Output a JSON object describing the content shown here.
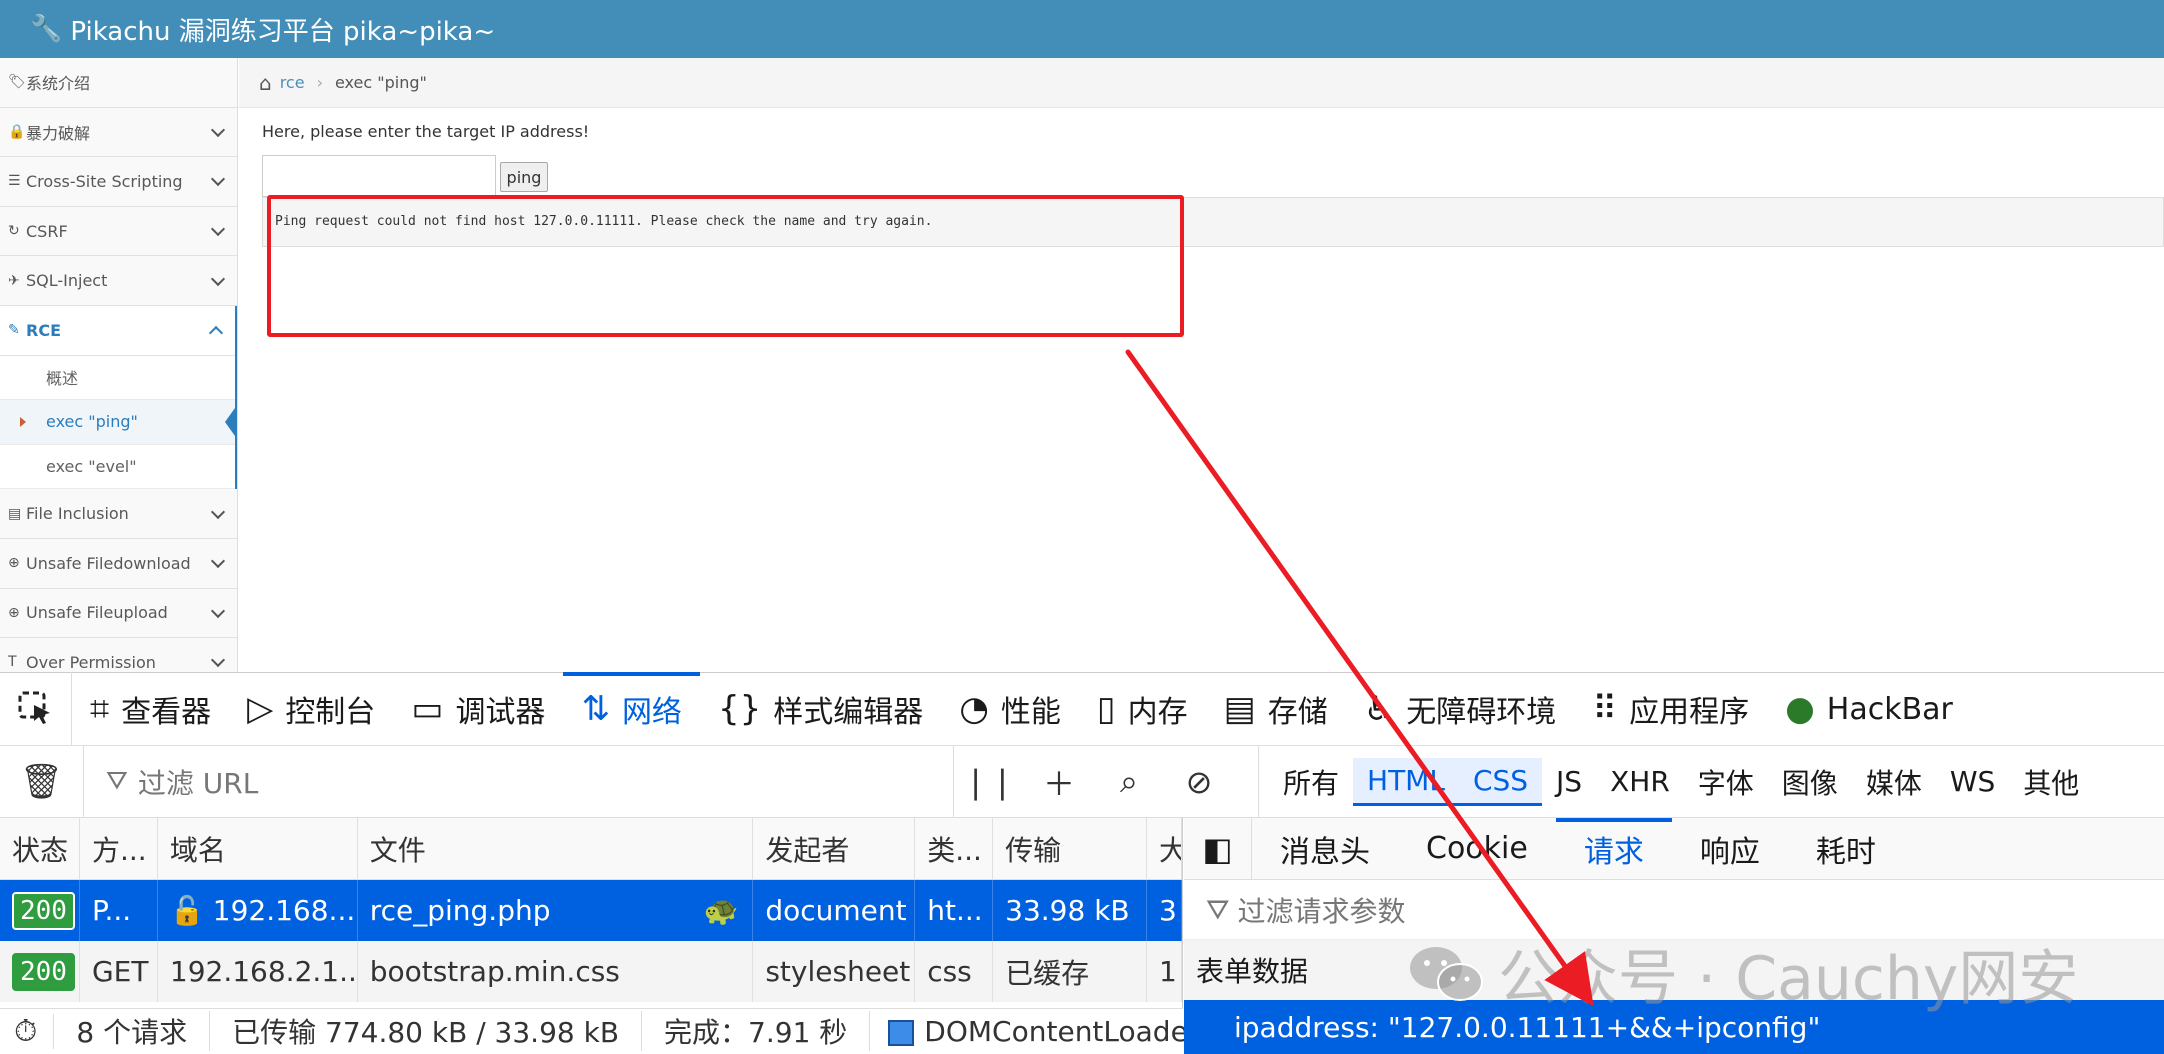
{
  "app": {
    "title": "Pikachu 漏洞练习平台 pika~pika~"
  },
  "sidebar": {
    "items": [
      {
        "label": "系统介绍",
        "icon": "tag-icon",
        "chevron": false
      },
      {
        "label": "暴力破解",
        "icon": "lock-icon",
        "chevron": true
      },
      {
        "label": "Cross-Site Scripting",
        "icon": "list-icon",
        "chevron": true
      },
      {
        "label": "CSRF",
        "icon": "refresh-icon",
        "chevron": true
      },
      {
        "label": "SQL-Inject",
        "icon": "plane-icon",
        "chevron": true
      }
    ],
    "rce": {
      "label": "RCE",
      "icon": "pencil-icon",
      "sub": [
        {
          "label": "概述"
        },
        {
          "label": "exec \"ping\""
        },
        {
          "label": "exec \"evel\""
        }
      ]
    },
    "after": [
      {
        "label": "File Inclusion",
        "icon": "file-icon"
      },
      {
        "label": "Unsafe Filedownload",
        "icon": "download-icon"
      },
      {
        "label": "Unsafe Fileupload",
        "icon": "upload-icon"
      },
      {
        "label": "Over Permission",
        "icon": "text-icon"
      }
    ]
  },
  "breadcrumb": {
    "link": "rce",
    "current": "exec \"ping\""
  },
  "form": {
    "prompt": "Here, please enter the target IP address!",
    "input_value": "",
    "button": "ping",
    "output": "Ping request could not find host 127.0.0.11111. Please check the name and try again."
  },
  "devtools": {
    "tabs": [
      {
        "label": "查看器",
        "icon": "inspector-icon"
      },
      {
        "label": "控制台",
        "icon": "console-icon"
      },
      {
        "label": "调试器",
        "icon": "debugger-icon"
      },
      {
        "label": "网络",
        "icon": "network-icon",
        "selected": true
      },
      {
        "label": "样式编辑器",
        "icon": "style-editor-icon"
      },
      {
        "label": "性能",
        "icon": "performance-icon"
      },
      {
        "label": "内存",
        "icon": "memory-icon"
      },
      {
        "label": "存储",
        "icon": "storage-icon"
      },
      {
        "label": "无障碍环境",
        "icon": "accessibility-icon"
      },
      {
        "label": "应用程序",
        "icon": "application-icon"
      },
      {
        "label": "HackBar",
        "icon": "hackbar-icon"
      }
    ],
    "filter_placeholder": "过滤 URL",
    "type_filters": [
      {
        "label": "所有"
      },
      {
        "label": "HTML",
        "on": true
      },
      {
        "label": "CSS",
        "on": true
      },
      {
        "label": "JS"
      },
      {
        "label": "XHR"
      },
      {
        "label": "字体"
      },
      {
        "label": "图像"
      },
      {
        "label": "媒体"
      },
      {
        "label": "WS"
      },
      {
        "label": "其他"
      }
    ],
    "columns": [
      "状态",
      "方...",
      "域名",
      "文件",
      "发起者",
      "类...",
      "传输",
      "大"
    ],
    "rows": [
      {
        "status": "200",
        "method": "P...",
        "domain": "192.168....",
        "file": "rce_ping.php",
        "initiator": "document",
        "type": "ht...",
        "transfer": "33.98 kB",
        "size": "3"
      },
      {
        "status": "200",
        "method": "GET",
        "domain": "192.168.2.1...",
        "file": "bootstrap.min.css",
        "initiator": "stylesheet",
        "type": "css",
        "transfer": "已缓存",
        "size": "1"
      }
    ],
    "status_bar": {
      "requests": "8 个请求",
      "transferred": "已传输 774.80 kB / 33.98 kB",
      "finish": "完成：7.91 秒",
      "dcl": "DOMContentLoaded"
    },
    "panel": {
      "tabs": [
        {
          "label": "消息头"
        },
        {
          "label": "Cookie"
        },
        {
          "label": "请求",
          "on": true
        },
        {
          "label": "响应"
        },
        {
          "label": "耗时"
        }
      ],
      "filter_placeholder": "过滤请求参数",
      "form_label": "表单数据",
      "form_row": "ipaddress: \"127.0.0.11111+&&+ipconfig\""
    }
  },
  "watermark": {
    "text": "公众号 · Cauchy网安"
  },
  "colors": {
    "topbar": "#438eb9",
    "accent": "#0061e0",
    "annotation": "#ec1c24",
    "status_ok": "#2e9c3f"
  }
}
